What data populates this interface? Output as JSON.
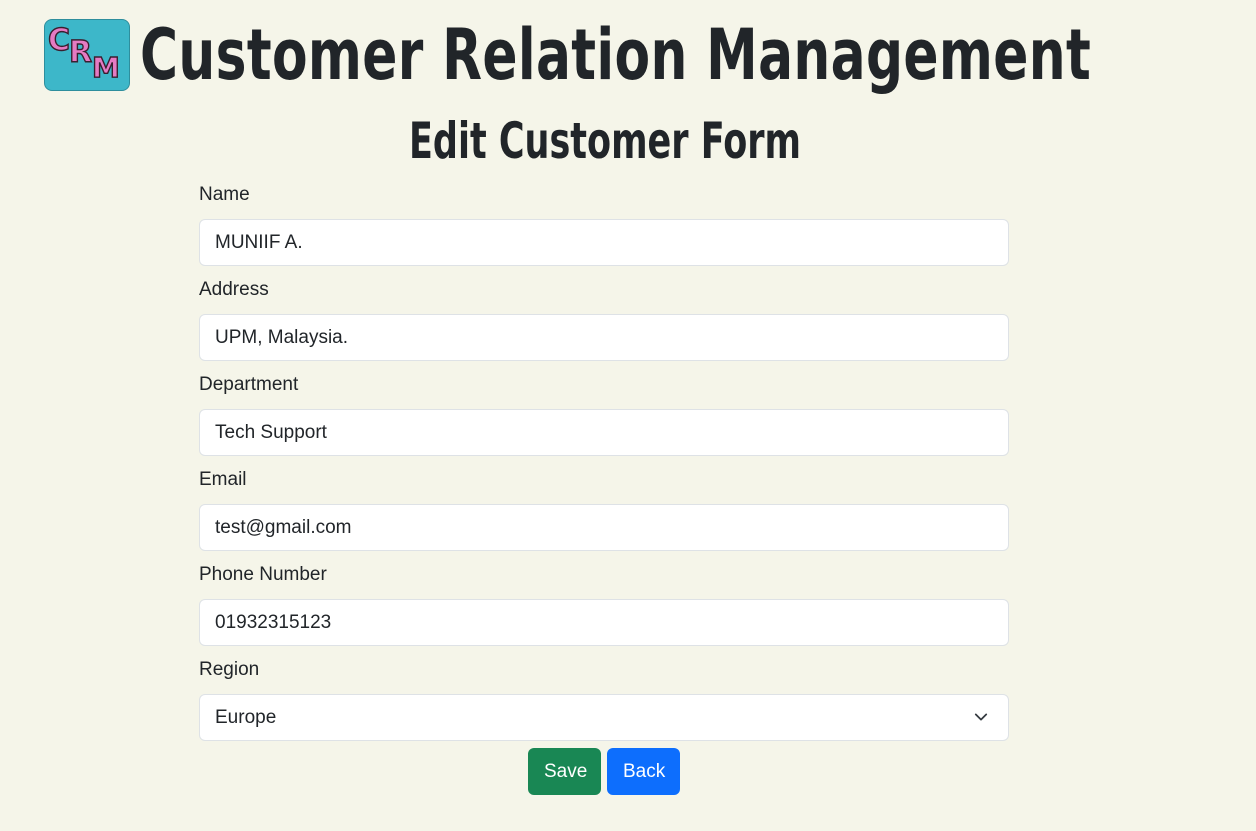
{
  "header": {
    "logo_letters": [
      "C",
      "R",
      "M"
    ],
    "app_title": "Customer Relation Management",
    "form_title": "Edit Customer Form"
  },
  "form": {
    "fields": [
      {
        "label": "Name",
        "value": "MUNIIF A."
      },
      {
        "label": "Address",
        "value": "UPM, Malaysia."
      },
      {
        "label": "Department",
        "value": "Tech Support"
      },
      {
        "label": "Email",
        "value": "test@gmail.com"
      },
      {
        "label": "Phone Number",
        "value": "01932315123"
      }
    ],
    "region": {
      "label": "Region",
      "selected": "Europe",
      "icon": "chevron-down-icon"
    }
  },
  "actions": {
    "save_label": "Save",
    "back_label": "Back"
  },
  "colors": {
    "background": "#f5f5e9",
    "logo_bg": "#3db7c9",
    "logo_letters": "#e57bc3",
    "save_button": "#198754",
    "back_button": "#0d6efd"
  }
}
